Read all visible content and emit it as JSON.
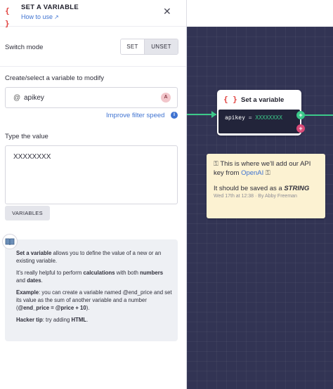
{
  "panel": {
    "title": "SET A VARIABLE",
    "how_to_use": "How to use",
    "switch_mode_label": "Switch mode",
    "set_label": "SET",
    "unset_label": "UNSET",
    "create_select_label": "Create/select a variable to modify",
    "variable_at": "@",
    "variable_name": "apikey",
    "variable_badge": "A",
    "improve_filter": "Improve filter speed",
    "type_value_label": "Type the value",
    "value_text": "XXXXXXXX",
    "variables_button": "VARIABLES"
  },
  "help": {
    "p1_strong": "Set a variable",
    "p1_rest": " allows you to define the value of a new or an existing variable.",
    "p2_a": "It's really helpful to perform ",
    "p2_b": "calculations",
    "p2_c": " with both ",
    "p2_d": "numbers",
    "p2_e": " and ",
    "p2_f": "dates",
    "p2_g": ".",
    "p3_a": "Example",
    "p3_b": ": you can create a variable named @end_price and set its value as the sum of another variable and a number (",
    "p3_c": "@end_price = @price + 10",
    "p3_d": ").",
    "p4_a": "Hacker tip",
    "p4_b": ": try adding ",
    "p4_c": "HTML",
    "p4_d": "."
  },
  "node": {
    "title": "Set a variable",
    "var": "apikey",
    "eq": "=",
    "value": "XXXXXXXX",
    "port_add": "+",
    "port_remove": "+"
  },
  "note": {
    "line1": "This is where we'll add our API key from ",
    "line1_link": "OpenAI",
    "save_prefix": "It should be saved as a ",
    "save_type": "STRING",
    "meta": "Wed 17th at 12:38 · By Abby Freeman"
  },
  "colors": {
    "canvas": "#323454",
    "accent_green": "#3cc98a",
    "accent_red": "#e0413e",
    "link_blue": "#3f73d1",
    "note_bg": "#fcf2d2"
  }
}
